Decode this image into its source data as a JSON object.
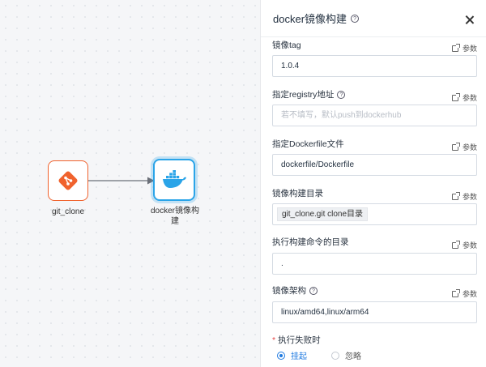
{
  "canvas": {
    "nodes": [
      {
        "label": "git_clone",
        "icon": "git-icon",
        "color": "#f0622d"
      },
      {
        "label": "docker镜像构建",
        "icon": "docker-icon",
        "color": "#2aa4e8"
      }
    ]
  },
  "panel": {
    "title": "docker镜像构建",
    "param_label": "参数",
    "fields": [
      {
        "label": "镜像tag",
        "value": "1.0.4"
      },
      {
        "label": "指定registry地址",
        "placeholder": "若不填写，默认push到dockerhub"
      },
      {
        "label": "指定Dockerfile文件",
        "value": "dockerfile/Dockerfile"
      },
      {
        "label": "镜像构建目录",
        "chip": "git_clone.git clone目录"
      },
      {
        "label": "执行构建命令的目录",
        "value": "."
      },
      {
        "label": "镜像架构",
        "value": "linux/amd64,linux/arm64"
      }
    ],
    "failure": {
      "label": "执行失败时",
      "required_mark": "*",
      "options": [
        "挂起",
        "忽略"
      ],
      "selected": "挂起"
    }
  },
  "colors": {
    "accent": "#1f7ae0",
    "git": "#f0622d",
    "docker": "#2aa4e8"
  }
}
